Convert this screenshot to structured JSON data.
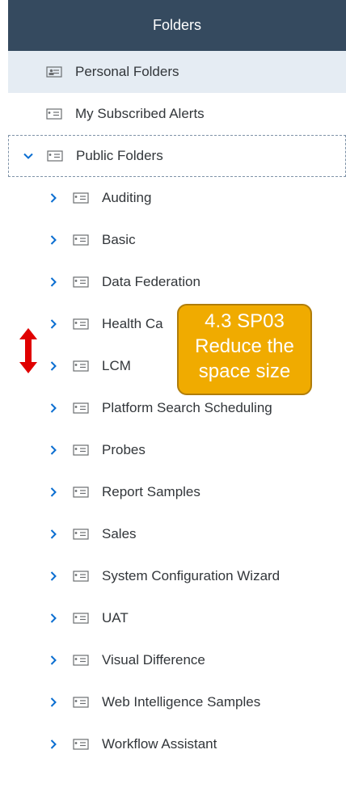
{
  "header": {
    "title": "Folders"
  },
  "tree": [
    {
      "label": "Personal Folders",
      "level": 0,
      "expandable": false,
      "selected": true,
      "icon": "personal-folder-icon"
    },
    {
      "label": "My Subscribed Alerts",
      "level": 0,
      "expandable": false,
      "icon": "folder-icon"
    },
    {
      "label": "Public Folders",
      "level": 0,
      "expandable": true,
      "expanded": true,
      "focused": true,
      "icon": "folder-icon"
    },
    {
      "label": "Auditing",
      "level": 1,
      "expandable": true,
      "icon": "folder-icon"
    },
    {
      "label": "Basic",
      "level": 1,
      "expandable": true,
      "icon": "folder-icon"
    },
    {
      "label": "Data Federation",
      "level": 1,
      "expandable": true,
      "icon": "folder-icon"
    },
    {
      "label": "Health Ca",
      "level": 1,
      "expandable": true,
      "icon": "folder-icon"
    },
    {
      "label": "LCM",
      "level": 1,
      "expandable": true,
      "icon": "folder-icon"
    },
    {
      "label": "Platform Search Scheduling",
      "level": 1,
      "expandable": true,
      "icon": "folder-icon"
    },
    {
      "label": "Probes",
      "level": 1,
      "expandable": true,
      "icon": "folder-icon"
    },
    {
      "label": "Report Samples",
      "level": 1,
      "expandable": true,
      "icon": "folder-icon"
    },
    {
      "label": "Sales",
      "level": 1,
      "expandable": true,
      "icon": "folder-icon"
    },
    {
      "label": "System Configuration Wizard",
      "level": 1,
      "expandable": true,
      "icon": "folder-icon"
    },
    {
      "label": "UAT",
      "level": 1,
      "expandable": true,
      "icon": "folder-icon"
    },
    {
      "label": "Visual Difference",
      "level": 1,
      "expandable": true,
      "icon": "folder-icon"
    },
    {
      "label": "Web Intelligence Samples",
      "level": 1,
      "expandable": true,
      "icon": "folder-icon"
    },
    {
      "label": "Workflow Assistant",
      "level": 1,
      "expandable": true,
      "icon": "folder-icon"
    }
  ],
  "annotation": {
    "line1": "4.3 SP03",
    "line2": "Reduce the",
    "line3": "space size"
  },
  "colors": {
    "header_bg": "#354a5f",
    "selected_bg": "#e5ecf3",
    "chevron": "#0a6ed1",
    "callout_bg": "#f0ab00",
    "arrow": "#e00000"
  }
}
